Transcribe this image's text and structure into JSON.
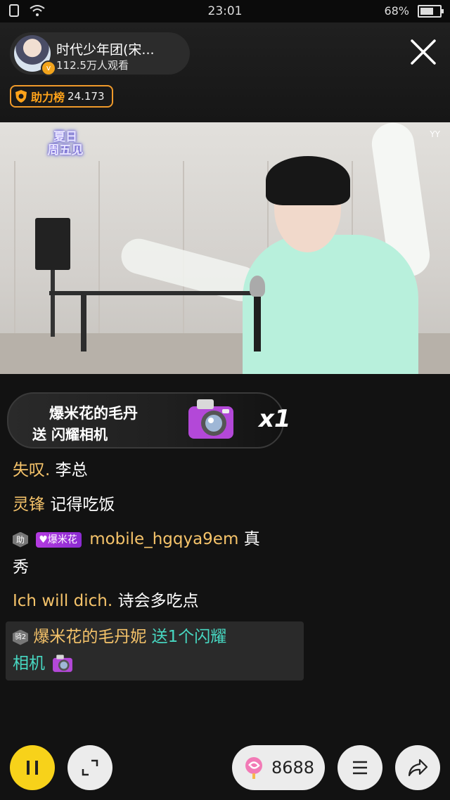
{
  "status_bar": {
    "time": "23:01",
    "battery": "68%",
    "battery_level": 0.68
  },
  "host": {
    "name": "时代少年团(宋...",
    "viewers": "112.5万人观看"
  },
  "ranking": {
    "label": "助力榜",
    "score": "24.173"
  },
  "video": {
    "brand_logo_line1": "夏日",
    "brand_logo_line2": "周五见",
    "corner_mark": "YY"
  },
  "gift_banner": {
    "sender": "爆米花的毛丹",
    "action": "送 闪耀相机",
    "count": "x1",
    "icon": "camera-gift-icon"
  },
  "chat": [
    {
      "user": "失叹.",
      "text": "李总"
    },
    {
      "user": "灵锋",
      "text": "记得吃饭"
    },
    {
      "badge_level": "助",
      "fan_badge": "爆米花",
      "user": "mobile_hgqya9em",
      "text": "真",
      "text_cont": "秀"
    },
    {
      "user": "Ich will dich.",
      "text": "诗会多吃点"
    }
  ],
  "gift_message": {
    "level": "骑2",
    "user": "爆米花的毛丹妮",
    "text": "送1个闪耀",
    "text_cont": "相机"
  },
  "bottom_bar": {
    "gift_balance": "8688"
  },
  "colors": {
    "accent": "#f7d21a",
    "username": "#f5c36a",
    "gift_text": "#47d8c2",
    "ranking": "#ffa31a"
  }
}
